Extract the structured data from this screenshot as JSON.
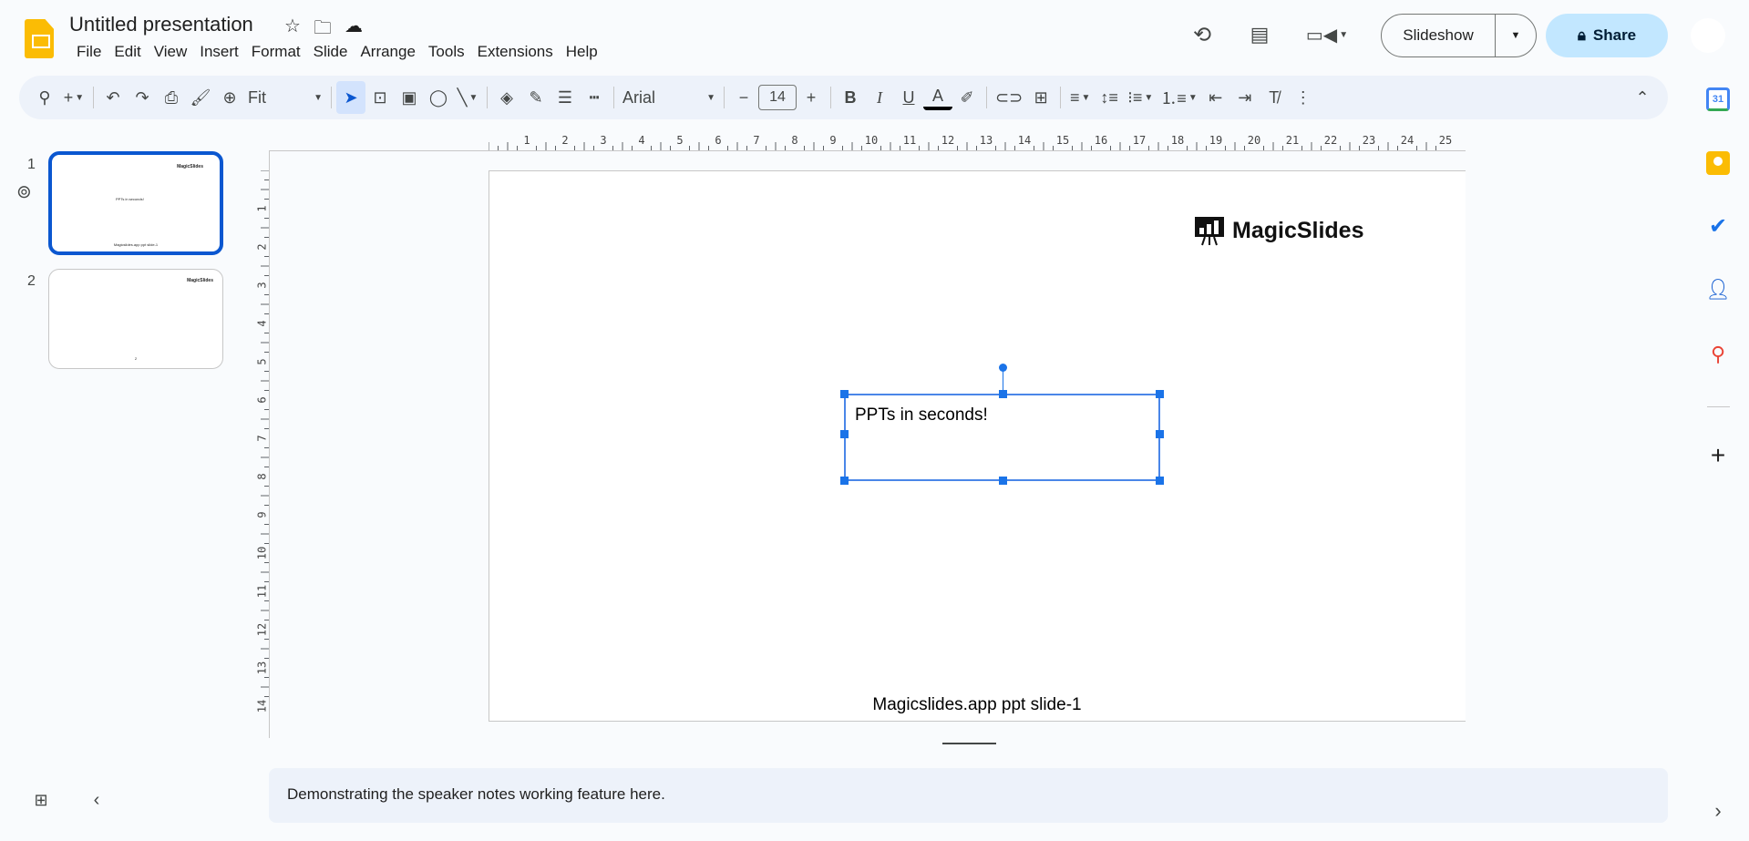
{
  "header": {
    "title": "Untitled presentation",
    "menu": [
      "File",
      "Edit",
      "View",
      "Insert",
      "Format",
      "Slide",
      "Arrange",
      "Tools",
      "Extensions",
      "Help"
    ],
    "slideshow_label": "Slideshow",
    "share_label": "Share"
  },
  "toolbar": {
    "zoom": "Fit",
    "font": "Arial",
    "font_size": "14"
  },
  "thumbnails": [
    {
      "number": "1",
      "logo": "MagicSlides",
      "text": "PPTs in seconds!",
      "footer": "Magicslides.app ppt slide-1"
    },
    {
      "number": "2",
      "logo": "MagicSlides",
      "footer": "2"
    }
  ],
  "slide": {
    "logo_text": "MagicSlides",
    "textbox": "PPTs in seconds!",
    "footer": "Magicslides.app ppt slide-1"
  },
  "ruler": {
    "horizontal": [
      "1",
      "2",
      "3",
      "4",
      "5",
      "6",
      "7",
      "8",
      "9",
      "10",
      "11",
      "12",
      "13",
      "14",
      "15",
      "16",
      "17",
      "18",
      "19",
      "20",
      "21",
      "22",
      "23",
      "24",
      "25"
    ],
    "vertical": [
      "1",
      "2",
      "3",
      "4",
      "5",
      "6",
      "7",
      "8",
      "9",
      "10",
      "11",
      "12",
      "13",
      "14"
    ]
  },
  "notes": "Demonstrating the speaker notes working feature here.",
  "side_panel": {
    "calendar_day": "31"
  },
  "colors": {
    "accent": "#0b57d0",
    "share_bg": "#c2e7ff",
    "toolbar_bg": "#edf2fa"
  }
}
